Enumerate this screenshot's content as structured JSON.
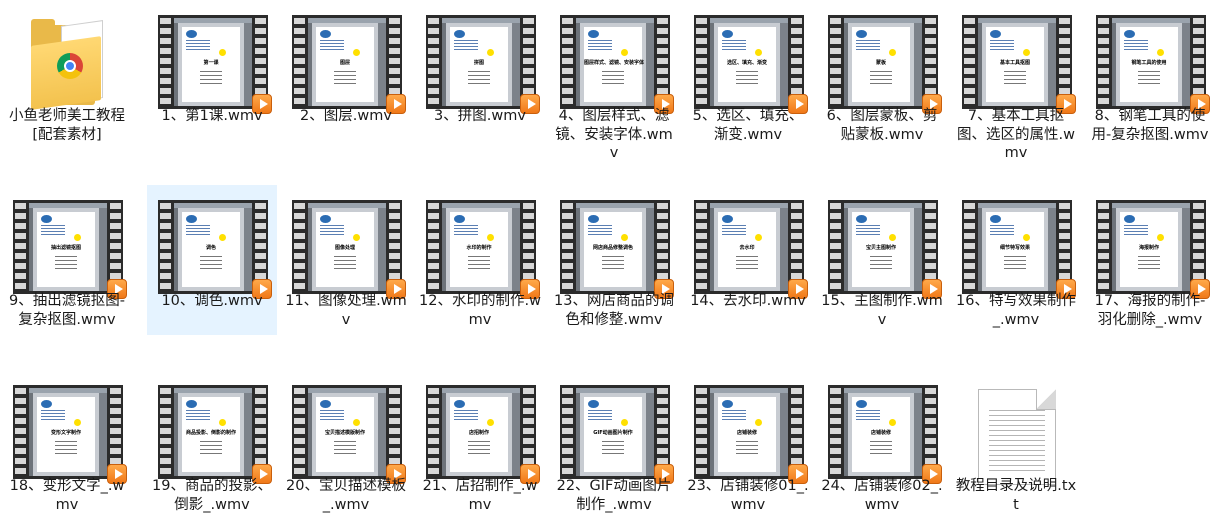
{
  "items": [
    {
      "label": "小鱼老师美工教程[配套素材]",
      "type": "folder",
      "slide_title": ""
    },
    {
      "label": "1、第1课.wmv",
      "type": "video",
      "slide_title": "第一课"
    },
    {
      "label": "2、图层.wmv",
      "type": "video",
      "slide_title": "图层"
    },
    {
      "label": "3、拼图.wmv",
      "type": "video",
      "slide_title": "拼图"
    },
    {
      "label": "4、图层样式、滤镜、安装字体.wmv",
      "type": "video",
      "slide_title": "图层样式、滤镜、安装字体"
    },
    {
      "label": "5、选区、填充、渐变.wmv",
      "type": "video",
      "slide_title": "选区、填充、渐变"
    },
    {
      "label": "6、图层蒙板、剪贴蒙板.wmv",
      "type": "video",
      "slide_title": "蒙板"
    },
    {
      "label": "7、基本工具抠图、选区的属性.wmv",
      "type": "video",
      "slide_title": "基本工具抠图"
    },
    {
      "label": "8、钢笔工具的使用-复杂抠图.wmv",
      "type": "video",
      "slide_title": "钢笔工具的使用"
    },
    {
      "label": "9、抽出滤镜抠图-复杂抠图.wmv",
      "type": "video",
      "slide_title": "抽出滤镜抠图"
    },
    {
      "label": "10、调色.wmv",
      "type": "video",
      "slide_title": "调色",
      "selected": true
    },
    {
      "label": "11、图像处理.wmv",
      "type": "video",
      "slide_title": "图像处理"
    },
    {
      "label": "12、水印的制作.wmv",
      "type": "video",
      "slide_title": "水印的制作"
    },
    {
      "label": "13、网店商品的调色和修整.wmv",
      "type": "video",
      "slide_title": "网店商品修整调色"
    },
    {
      "label": "14、去水印.wmv",
      "type": "video",
      "slide_title": "去水印"
    },
    {
      "label": "15、主图制作.wmv",
      "type": "video",
      "slide_title": "宝贝主图制作"
    },
    {
      "label": "16、特写效果制作_.wmv",
      "type": "video",
      "slide_title": "细节特写效果"
    },
    {
      "label": "17、海报的制作-羽化删除_.wmv",
      "type": "video",
      "slide_title": "海报制作"
    },
    {
      "label": "18、变形文字_.wmv",
      "type": "video",
      "slide_title": "变形文字制作"
    },
    {
      "label": "19、商品的投影、倒影_.wmv",
      "type": "video",
      "slide_title": "商品投影、倒影的制作"
    },
    {
      "label": "20、宝贝描述模板_.wmv",
      "type": "video",
      "slide_title": "宝贝描述模版制作"
    },
    {
      "label": "21、店招制作_.wmv",
      "type": "video",
      "slide_title": "店招制作"
    },
    {
      "label": "22、GIF动画图片制作_.wmv",
      "type": "video",
      "slide_title": "GIF动画图片制作"
    },
    {
      "label": "23、店铺装修01_.wmv",
      "type": "video",
      "slide_title": "店铺装修"
    },
    {
      "label": "24、店铺装修02_.wmv",
      "type": "video",
      "slide_title": "店铺装修"
    },
    {
      "label": "教程目录及说明.txt",
      "type": "text",
      "slide_title": ""
    }
  ]
}
